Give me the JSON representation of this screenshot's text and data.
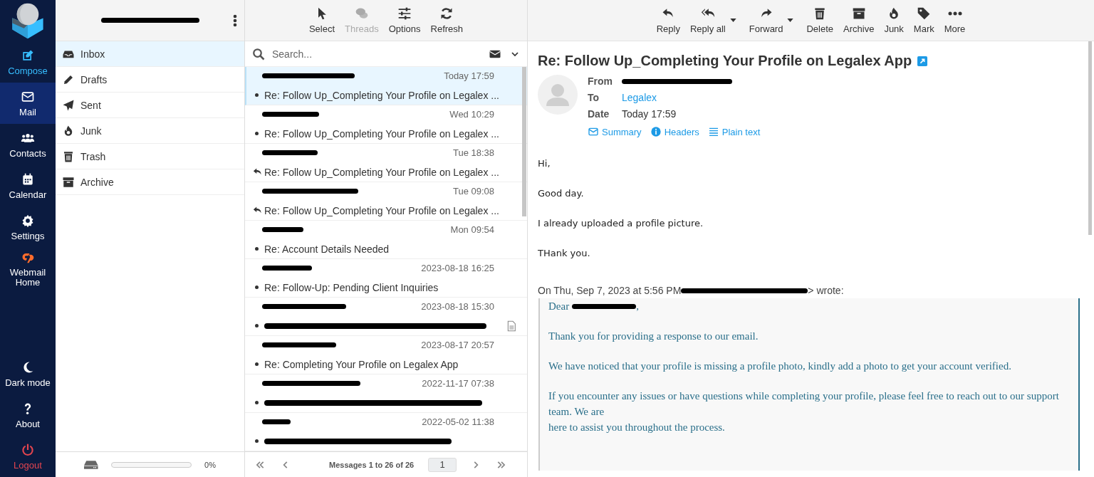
{
  "nav": {
    "items": [
      {
        "label": "Compose",
        "kind": "accent",
        "selected": false
      },
      {
        "label": "Mail",
        "kind": "plain",
        "selected": true
      },
      {
        "label": "Contacts",
        "kind": "plain",
        "selected": false
      },
      {
        "label": "Calendar",
        "kind": "plain",
        "selected": false
      },
      {
        "label": "Settings",
        "kind": "plain",
        "selected": false
      },
      {
        "label": "Webmail Home",
        "kind": "plain",
        "selected": false
      }
    ],
    "bottom_items": [
      {
        "label": "Dark mode",
        "kind": "plain"
      },
      {
        "label": "About",
        "kind": "plain"
      },
      {
        "label": "Logout",
        "kind": "danger"
      }
    ]
  },
  "folders": {
    "items": [
      {
        "label": "Inbox",
        "selected": true
      },
      {
        "label": "Drafts",
        "selected": false
      },
      {
        "label": "Sent",
        "selected": false
      },
      {
        "label": "Junk",
        "selected": false
      },
      {
        "label": "Trash",
        "selected": false
      },
      {
        "label": "Archive",
        "selected": false
      }
    ],
    "quota": {
      "level": 0,
      "reading": "0%"
    }
  },
  "list_toolbar": [
    {
      "label": "Select",
      "disabled": false
    },
    {
      "label": "Threads",
      "disabled": true
    },
    {
      "label": "Options",
      "disabled": false
    },
    {
      "label": "Refresh",
      "disabled": false
    }
  ],
  "search": {
    "placeholder": "Search..."
  },
  "messages": [
    {
      "date": "Today 17:59",
      "subject": "Re: Follow Up_Completing Your Profile on Legalex ...",
      "replied": false,
      "selected": true,
      "attachment": false
    },
    {
      "date": "Wed 10:29",
      "subject": "Re: Follow Up_Completing Your Profile on Legalex ...",
      "replied": false,
      "selected": false,
      "attachment": false
    },
    {
      "date": "Tue 18:38",
      "subject": "Re: Follow Up_Completing Your Profile on Legalex ...",
      "replied": true,
      "selected": false,
      "attachment": false
    },
    {
      "date": "Tue 09:08",
      "subject": "Re: Follow Up_Completing Your Profile on Legalex ...",
      "replied": true,
      "selected": false,
      "attachment": false
    },
    {
      "date": "Mon 09:54",
      "subject": "Re: Account Details Needed",
      "replied": false,
      "selected": false,
      "attachment": false
    },
    {
      "date": "2023-08-18 16:25",
      "subject": "Re: Follow-Up: Pending Client Inquiries",
      "replied": false,
      "selected": false,
      "attachment": false
    },
    {
      "date": "2023-08-18 15:30",
      "replied": false,
      "selected": false,
      "attachment": true
    },
    {
      "date": "2023-08-17 20:57",
      "subject": "Re: Completing Your Profile on Legalex App",
      "replied": false,
      "selected": false,
      "attachment": false
    },
    {
      "date": "2022-11-17 07:38",
      "replied": false,
      "selected": false,
      "attachment": false
    },
    {
      "date": "2022-05-02 11:38",
      "replied": false,
      "selected": false,
      "attachment": false
    }
  ],
  "pager": {
    "summary": "Messages 1 to 26 of 26",
    "page": "1"
  },
  "message_toolbar": [
    {
      "label": "Reply",
      "dropdown": false
    },
    {
      "label": "Reply all",
      "dropdown": true
    },
    {
      "label": "Forward",
      "dropdown": true
    },
    {
      "label": "Delete",
      "dropdown": false
    },
    {
      "label": "Archive",
      "dropdown": false
    },
    {
      "label": "Junk",
      "dropdown": false
    },
    {
      "label": "Mark",
      "dropdown": false
    },
    {
      "label": "More",
      "dropdown": false
    }
  ],
  "message": {
    "subject": "Re: Follow Up_Completing Your Profile on Legalex App",
    "headers": [
      {
        "label": "From"
      },
      {
        "label": "To",
        "value": "Legalex",
        "link": true
      },
      {
        "label": "Date",
        "value": "Today 17:59",
        "link": false
      }
    ],
    "views": [
      {
        "label": "Summary"
      },
      {
        "label": "Headers"
      },
      {
        "label": "Plain text"
      }
    ],
    "body": [
      "Hi,",
      "Good day.",
      "I already uploaded a profile picture.",
      "THank you."
    ],
    "attribution": {
      "before": "On Thu, Sep 7, 2023 at 5:56 PM",
      "after": "> wrote:"
    },
    "quote": {
      "greeting": {
        "before": "Dear",
        "after": ","
      },
      "paragraphs": [
        [
          "Thank you for providing a response to our email."
        ],
        [
          "We have noticed that your profile is missing a profile photo, kindly add a photo to get your account verified."
        ],
        [
          "If you encounter any issues or have questions while completing your profile, please feel free to reach out to our support team. We are",
          "here to assist you throughout the process."
        ]
      ]
    }
  }
}
